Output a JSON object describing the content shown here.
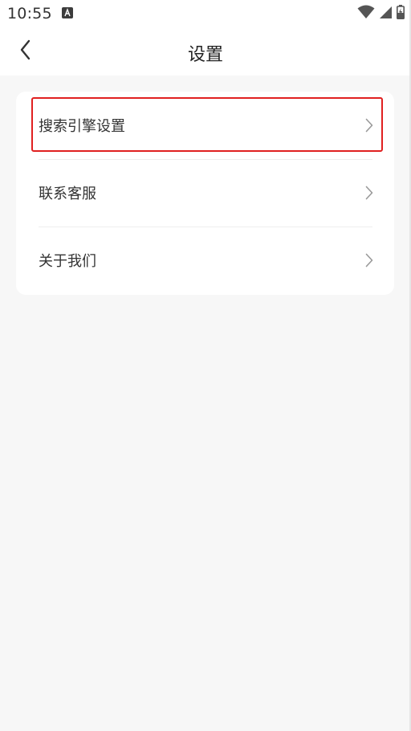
{
  "status_bar": {
    "time": "10:55",
    "notification_icon": "a-app-icon",
    "wifi_icon": "wifi-icon",
    "signal_icon": "signal-icon",
    "battery_icon": "battery-charging-icon"
  },
  "header": {
    "back_icon": "chevron-left-icon",
    "title": "设置"
  },
  "menu": {
    "items": [
      {
        "label": "搜索引擎设置",
        "icon": "chevron-right-icon",
        "highlighted": true
      },
      {
        "label": "联系客服",
        "icon": "chevron-right-icon"
      },
      {
        "label": "关于我们",
        "icon": "chevron-right-icon"
      }
    ]
  },
  "colors": {
    "background": "#f7f7f7",
    "card": "#ffffff",
    "highlight": "#e02020",
    "text": "#333333",
    "chevron": "#999999"
  }
}
